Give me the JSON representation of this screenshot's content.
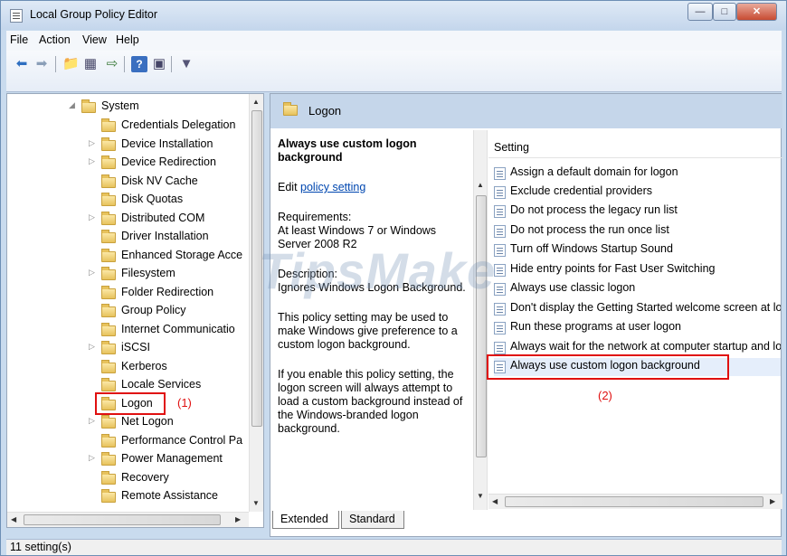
{
  "window": {
    "title": "Local Group Policy Editor"
  },
  "menu": [
    "File",
    "Action",
    "View",
    "Help"
  ],
  "toolbar_icons": [
    "back-arrow-icon",
    "forward-arrow-icon",
    "up-folder-icon",
    "show-hide-tree-icon",
    "export-list-icon",
    "help-icon",
    "properties-icon",
    "filter-icon"
  ],
  "tree": {
    "parent": "System",
    "items": [
      {
        "label": "Credentials Delegation",
        "expandable": false
      },
      {
        "label": "Device Installation",
        "expandable": true
      },
      {
        "label": "Device Redirection",
        "expandable": true
      },
      {
        "label": "Disk NV Cache",
        "expandable": false
      },
      {
        "label": "Disk Quotas",
        "expandable": false
      },
      {
        "label": "Distributed COM",
        "expandable": true
      },
      {
        "label": "Driver Installation",
        "expandable": false
      },
      {
        "label": "Enhanced Storage Acce",
        "expandable": false
      },
      {
        "label": "Filesystem",
        "expandable": true
      },
      {
        "label": "Folder Redirection",
        "expandable": false
      },
      {
        "label": "Group Policy",
        "expandable": false
      },
      {
        "label": "Internet Communicatio",
        "expandable": true
      },
      {
        "label": "iSCSI",
        "expandable": true
      },
      {
        "label": "Kerberos",
        "expandable": false
      },
      {
        "label": "Locale Services",
        "expandable": false
      },
      {
        "label": "Logon",
        "expandable": false,
        "selected": true
      },
      {
        "label": "Net Logon",
        "expandable": true
      },
      {
        "label": "Performance Control Pa",
        "expandable": false
      },
      {
        "label": "Power Management",
        "expandable": true
      },
      {
        "label": "Recovery",
        "expandable": false
      },
      {
        "label": "Remote Assistance",
        "expandable": false
      }
    ]
  },
  "right": {
    "header": "Logon",
    "desc": {
      "title": "Always use custom logon background",
      "edit_prefix": "Edit ",
      "edit_link": "policy setting",
      "requirements_label": "Requirements:",
      "requirements_text": "At least Windows 7 or Windows Server 2008 R2",
      "description_label": "Description:",
      "description_text": "Ignores Windows Logon Background.",
      "para1": "This policy setting may be used to make Windows give preference to a custom logon background.",
      "para2": "If you enable this policy setting, the logon screen will always attempt to load a custom background instead of the Windows-branded logon background."
    },
    "settings_header": "Setting",
    "settings": [
      "Assign a default domain for logon",
      "Exclude credential providers",
      "Do not process the legacy run list",
      "Do not process the run once list",
      "Turn off Windows Startup Sound",
      "Hide entry points for Fast User Switching",
      "Always use classic logon",
      "Don't display the Getting Started welcome screen at logon",
      "Run these programs at user logon",
      "Always wait for the network at computer startup and logon",
      "Always use custom logon background"
    ],
    "tabs": [
      "Extended",
      "Standard"
    ]
  },
  "status": "11 setting(s)",
  "annotations": {
    "a1": "(1)",
    "a2": "(2)"
  },
  "watermark": "TipsMake",
  "colors": {
    "annotation": "#e01010",
    "header_bg": "#c5d6ea",
    "link": "#0047b0"
  }
}
